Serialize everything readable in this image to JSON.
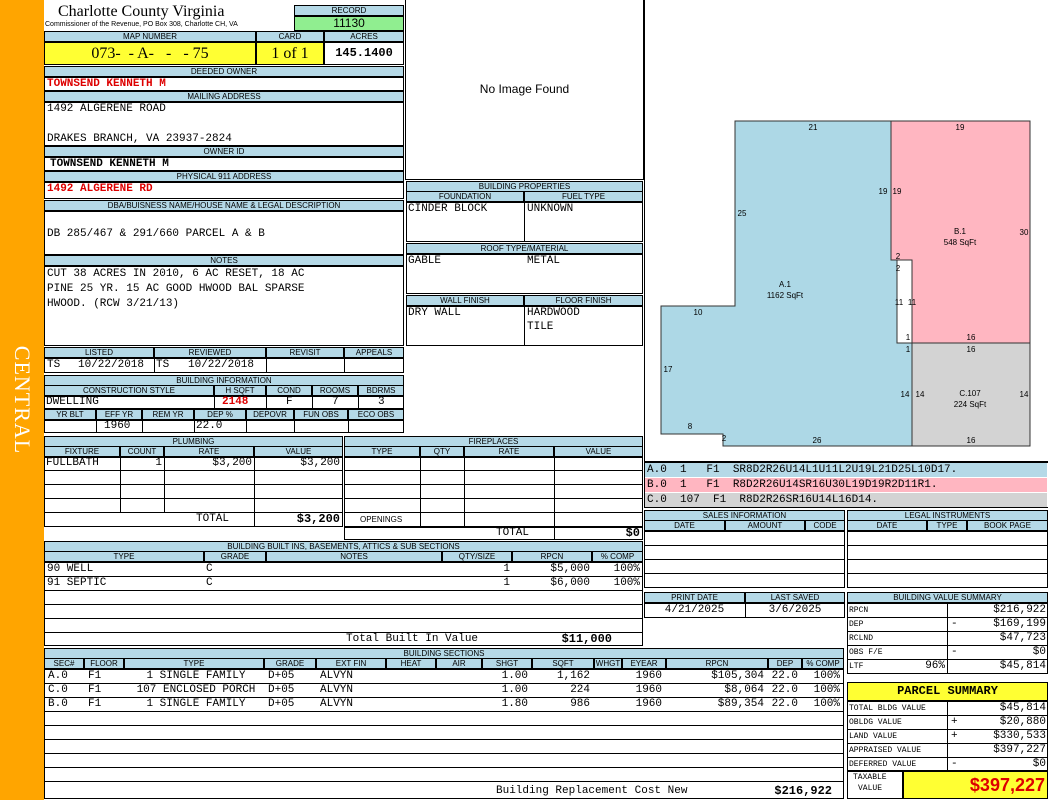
{
  "sidebar_label": "CENTRAL",
  "county": {
    "title": "Charlotte County Virginia",
    "subtitle": "Commissioner of the Revenue, PO Box 308, Charlotte CH, VA"
  },
  "record": {
    "label": "RECORD",
    "value": "11130"
  },
  "map": {
    "label": "MAP NUMBER",
    "value": "073-  - A-   -   - 75",
    "card_label": "CARD",
    "card": "1 of 1",
    "acres_label": "ACRES",
    "acres": "145.1400"
  },
  "owner": {
    "deeded_label": "DEEDED OWNER",
    "deeded": "TOWNSEND KENNETH M",
    "mailing_label": "MAILING ADDRESS",
    "mail1": "1492 ALGERENE ROAD",
    "mail2": "DRAKES BRANCH, VA 23937-2824",
    "owner_id_label": "OWNER ID",
    "owner_id": "TOWNSEND KENNETH M",
    "phys_label": "PHYSICAL 911 ADDRESS",
    "phys": "1492 ALGERENE RD"
  },
  "legal": {
    "label": "DBA/BUISNESS NAME/HOUSE NAME & LEGAL DESCRIPTION",
    "value": "DB 285/467 & 291/660 PARCEL A & B"
  },
  "notes": {
    "label": "NOTES",
    "lines": [
      "CUT 38 ACRES IN 2010, 6 AC RESET, 18 AC",
      "PINE 25 YR. 15 AC GOOD HWOOD BAL SPARSE",
      "HWOOD. (RCW 3/21/13)"
    ]
  },
  "listing": {
    "listed_label": "LISTED",
    "reviewed_label": "REVIEWED",
    "revisit_label": "REVISIT",
    "appeals_label": "APPEALS",
    "listed_by": "TS",
    "listed_date": "10/22/2018",
    "reviewed_by": "TS",
    "reviewed_date": "10/22/2018"
  },
  "building_info": {
    "label": "BUILDING INFORMATION",
    "style_label": "CONSTRUCTION STYLE",
    "hsqft_label": "H SQFT",
    "cond_label": "COND",
    "rooms_label": "ROOMS",
    "bdrms_label": "BDRMS",
    "style": "DWELLING",
    "hsqft": "2148",
    "cond": "F",
    "rooms": "7",
    "bdrms": "3",
    "yrblt_label": "YR BLT",
    "effyr_label": "EFF YR",
    "remyr_label": "REM YR",
    "dep_label": "DEP %",
    "depovr_label": "DEPOVR",
    "funobs_label": "FUN OBS",
    "ecoobs_label": "ECO OBS",
    "effyr": "1960",
    "dep": "22.0"
  },
  "image": {
    "text": "No Image Found"
  },
  "building_props": {
    "label": "BUILDING PROPERTIES",
    "foundation_label": "FOUNDATION",
    "fuel_label": "FUEL TYPE",
    "foundation": "CINDER BLOCK",
    "fuel": "UNKNOWN",
    "roof_label": "ROOF TYPE/MATERIAL",
    "roof_type": "GABLE",
    "roof_material": "METAL",
    "wall_label": "WALL FINISH",
    "floor_label": "FLOOR FINISH",
    "wall": "DRY WALL",
    "floor1": "HARDWOOD",
    "floor2": "TILE"
  },
  "plumbing": {
    "label": "PLUMBING",
    "headers": [
      "FIXTURE",
      "COUNT",
      "RATE",
      "VALUE"
    ],
    "rows": [
      {
        "fixture": "FULLBATH",
        "count": "1",
        "rate": "$3,200",
        "value": "$3,200"
      }
    ],
    "total_label": "TOTAL",
    "total": "$3,200"
  },
  "fireplaces": {
    "label": "FIREPLACES",
    "headers": [
      "TYPE",
      "QTY",
      "RATE",
      "VALUE"
    ],
    "openings_label": "OPENINGS",
    "total_label": "TOTAL",
    "total": "$0"
  },
  "sketch": {
    "areas": [
      {
        "name": "A.1",
        "sqft": "1162 SqFt"
      },
      {
        "name": "B.1",
        "sqft": "548 SqFt"
      },
      {
        "name": "C.107",
        "sqft": "224 SqFt"
      }
    ],
    "dims": [
      "21",
      "19",
      "25",
      "19",
      "19",
      "30",
      "2",
      "2",
      "11",
      "11",
      "10",
      "17",
      "1",
      "16",
      "1",
      "16",
      "14",
      "14",
      "14",
      "8",
      "2",
      "26",
      "16"
    ]
  },
  "sketch_codes": [
    {
      "text": "A.0  1   F1  SR8D2R26U14L1U11L2U19L21D25L10D17.",
      "color": "#b5d9e7"
    },
    {
      "text": "B.0  1   F1  R8D2R26U14SR16U30L19D19R2D11R1.",
      "color": "#ffb6c1"
    },
    {
      "text": "C.0  107  F1  R8D2R26SR16U14L16D14.",
      "color": "#d3d3d3"
    }
  ],
  "sales": {
    "label": "SALES INFORMATION",
    "headers": [
      "DATE",
      "AMOUNT",
      "CODE"
    ]
  },
  "legal_instr": {
    "label": "LEGAL INSTRUMENTS",
    "headers": [
      "DATE",
      "TYPE",
      "BOOK PAGE"
    ]
  },
  "dates": {
    "print_label": "PRINT DATE",
    "print": "4/21/2025",
    "saved_label": "LAST SAVED",
    "saved": "3/6/2025"
  },
  "built_ins": {
    "label": "BUILDING BUILT INS, BASEMENTS, ATTICS & SUB SECTIONS",
    "headers": [
      "TYPE",
      "GRADE",
      "NOTES",
      "QTY/SIZE",
      "RPCN",
      "% COMP"
    ],
    "rows": [
      {
        "type": "90 WELL",
        "grade": "C",
        "notes": "",
        "qty": "1",
        "rpcn": "$5,000",
        "comp": "100%"
      },
      {
        "type": "91 SEPTIC",
        "grade": "C",
        "notes": "",
        "qty": "1",
        "rpcn": "$6,000",
        "comp": "100%"
      }
    ],
    "total_label": "Total Built In Value",
    "total": "$11,000"
  },
  "bvs": {
    "label": "BUILDING VALUE SUMMARY",
    "rows": [
      {
        "label": "RPCN",
        "sign": "",
        "value": "$216,922"
      },
      {
        "label": "DEP",
        "sign": "-",
        "value": "$169,199"
      },
      {
        "label": "RCLND",
        "sign": "",
        "value": "$47,723"
      },
      {
        "label": "OBS F/E",
        "sign": "-",
        "value": "$0"
      },
      {
        "label": "LTF",
        "pct": "96%",
        "sign": "",
        "value": "$45,814"
      }
    ]
  },
  "parcel": {
    "label": "PARCEL SUMMARY",
    "rows": [
      {
        "label": "TOTAL BLDG VALUE",
        "sign": "",
        "value": "$45,814"
      },
      {
        "label": "OBLDG VALUE",
        "sign": "+",
        "value": "$20,880"
      },
      {
        "label": "LAND VALUE",
        "sign": "+",
        "value": "$330,533"
      },
      {
        "label": "APPRAISED VALUE",
        "sign": "",
        "value": "$397,227"
      },
      {
        "label": "DEFERRED VALUE",
        "sign": "-",
        "value": "$0"
      }
    ],
    "taxable_label1": "TAXABLE",
    "taxable_label2": "VALUE",
    "taxable": "$397,227"
  },
  "sections": {
    "label": "BUILDING SECTIONS",
    "headers": [
      "SEC#",
      "FLOOR",
      "TYPE",
      "GRADE",
      "EXT FIN",
      "HEAT",
      "AIR",
      "SHGT",
      "SQFT",
      "WHGT",
      "EYEAR",
      "RPCN",
      "DEP",
      "% COMP"
    ],
    "rows": [
      {
        "sec": "A.0",
        "floor": "F1",
        "type": "1 SINGLE FAMILY",
        "grade": "D+05",
        "ext": "ALVYN",
        "shgt": "1.00",
        "sqft": "1,162",
        "eyear": "1960",
        "rpcn": "$105,304",
        "dep": "22.0",
        "comp": "100%"
      },
      {
        "sec": "C.0",
        "floor": "F1",
        "type": "107 ENCLOSED PORCH",
        "grade": "D+05",
        "ext": "ALVYN",
        "shgt": "1.00",
        "sqft": "224",
        "eyear": "1960",
        "rpcn": "$8,064",
        "dep": "22.0",
        "comp": "100%"
      },
      {
        "sec": "B.0",
        "floor": "F1",
        "type": "1 SINGLE FAMILY",
        "grade": "D+05",
        "ext": "ALVYN",
        "shgt": "1.80",
        "sqft": "986",
        "eyear": "1960",
        "rpcn": "$89,354",
        "dep": "22.0",
        "comp": "100%"
      }
    ],
    "total_label": "Building Replacement Cost New",
    "total": "$216,922"
  }
}
